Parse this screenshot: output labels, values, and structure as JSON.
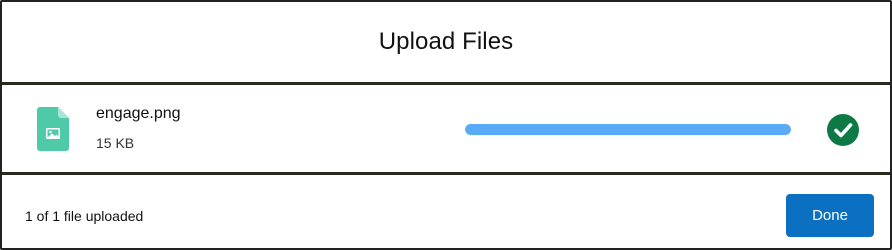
{
  "dialog": {
    "title": "Upload Files"
  },
  "file": {
    "name": "engage.png",
    "size": "15 KB",
    "icon": "image-file-icon",
    "progress": 1.0,
    "status_icon": "check-circle-icon"
  },
  "footer": {
    "status_text": "1 of 1 file uploaded",
    "done_label": "Done"
  },
  "colors": {
    "progress_fill": "#5aabf5",
    "file_icon": "#4fcaa8",
    "success": "#0d7a45",
    "primary_button": "#0b6fc2"
  }
}
